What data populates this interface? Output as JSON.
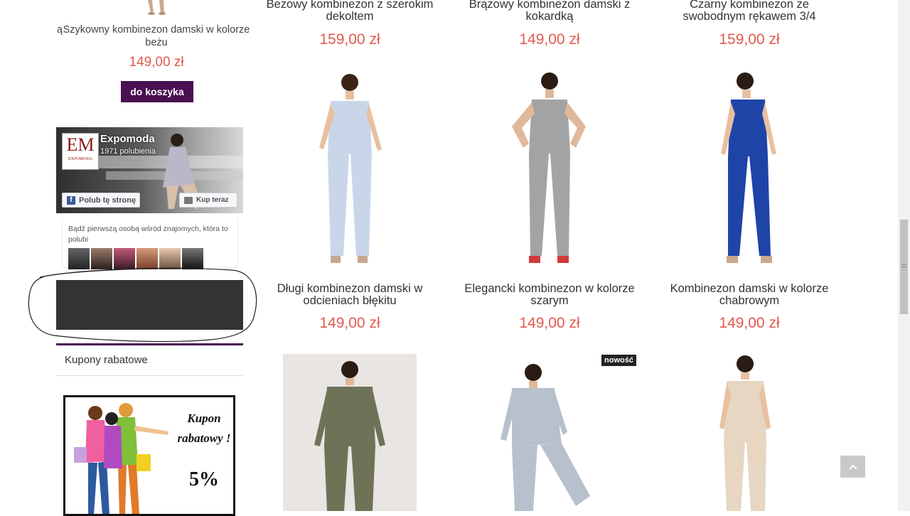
{
  "sidebar": {
    "product": {
      "prefix": "ą",
      "title": "Szykowny kombinezon damski w kolorze beżu",
      "price": "149,00 zł",
      "cart_button": "do koszyka"
    },
    "facebook": {
      "page_name": "Expomoda",
      "likes": "1971 polubienia",
      "logo_text": "EM",
      "logo_subtext": "EXPOMODA",
      "like_button": "Polub tę stronę",
      "shop_button": "Kup teraz",
      "friends_text": "Bądź pierwszą osobą wśród znajomych, która to polubi"
    },
    "coupons": {
      "heading": "Kupony rabatowe",
      "banner_line1": "Kupon",
      "banner_line2": "rabatowy !",
      "banner_percent": "5%"
    }
  },
  "products_row1": [
    {
      "title": "Beżowy kombinezon z szerokim dekoltem",
      "price": "159,00 zł"
    },
    {
      "title": "Brązowy kombinezon damski z kokardką",
      "price": "149,00 zł"
    },
    {
      "title": "Czarny kombinezon ze swobodnym rękawem 3/4",
      "price": "159,00 zł"
    }
  ],
  "products_row2": [
    {
      "title": "Długi kombinezon damski w odcieniach błękitu",
      "price": "149,00 zł",
      "color": "#c9d6ea"
    },
    {
      "title": "Elegancki kombinezon w kolorze szarym",
      "price": "149,00 zł",
      "color": "#a3a3a3"
    },
    {
      "title": "Kombinezon damski w kolorze chabrowym",
      "price": "149,00 zł",
      "color": "#1f44a8"
    }
  ],
  "products_row3": [
    {
      "color": "#6e7358",
      "badge": ""
    },
    {
      "color": "#b7c0cc",
      "badge": "nowość"
    },
    {
      "color": "#e6d6c2",
      "badge": ""
    }
  ],
  "icons": {
    "back_to_top": "chevron-up-icon"
  }
}
